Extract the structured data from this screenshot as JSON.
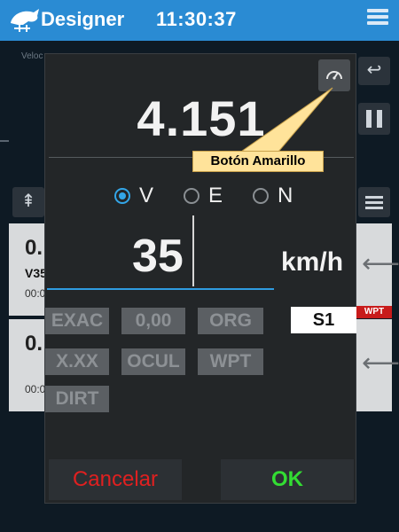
{
  "app": {
    "title": "Designer",
    "time": "11:30:37",
    "logo_icon": "horse-logo-icon",
    "menu_icon": "menu-icon"
  },
  "background": {
    "velocity_label": "Veloc",
    "card1": {
      "big": "0.",
      "code": "V35",
      "time": "00:0"
    },
    "card2": {
      "big": "0.",
      "time": "00:0"
    },
    "wpt_badge": "WPT"
  },
  "dialog": {
    "value": "4.151",
    "radios": [
      {
        "label": "V",
        "checked": true
      },
      {
        "label": "E",
        "checked": false
      },
      {
        "label": "N",
        "checked": false
      }
    ],
    "speed": "35",
    "unit": "km/h",
    "chips": {
      "exac": "EXAC",
      "zero": "0,00",
      "org": "ORG",
      "xxx": "X.XX",
      "ocul": "OCUL",
      "wpt": "WPT",
      "dirt": "DIRT"
    },
    "selected": "S1",
    "cancel": "Cancelar",
    "ok": "OK"
  },
  "annotation": {
    "text": "Botón Amarillo"
  },
  "colors": {
    "appbar": "#2a8bd3",
    "radio_active": "#33a6e8",
    "cancel": "#e02020",
    "ok": "#33dd33",
    "callout": "#ffe39a"
  }
}
